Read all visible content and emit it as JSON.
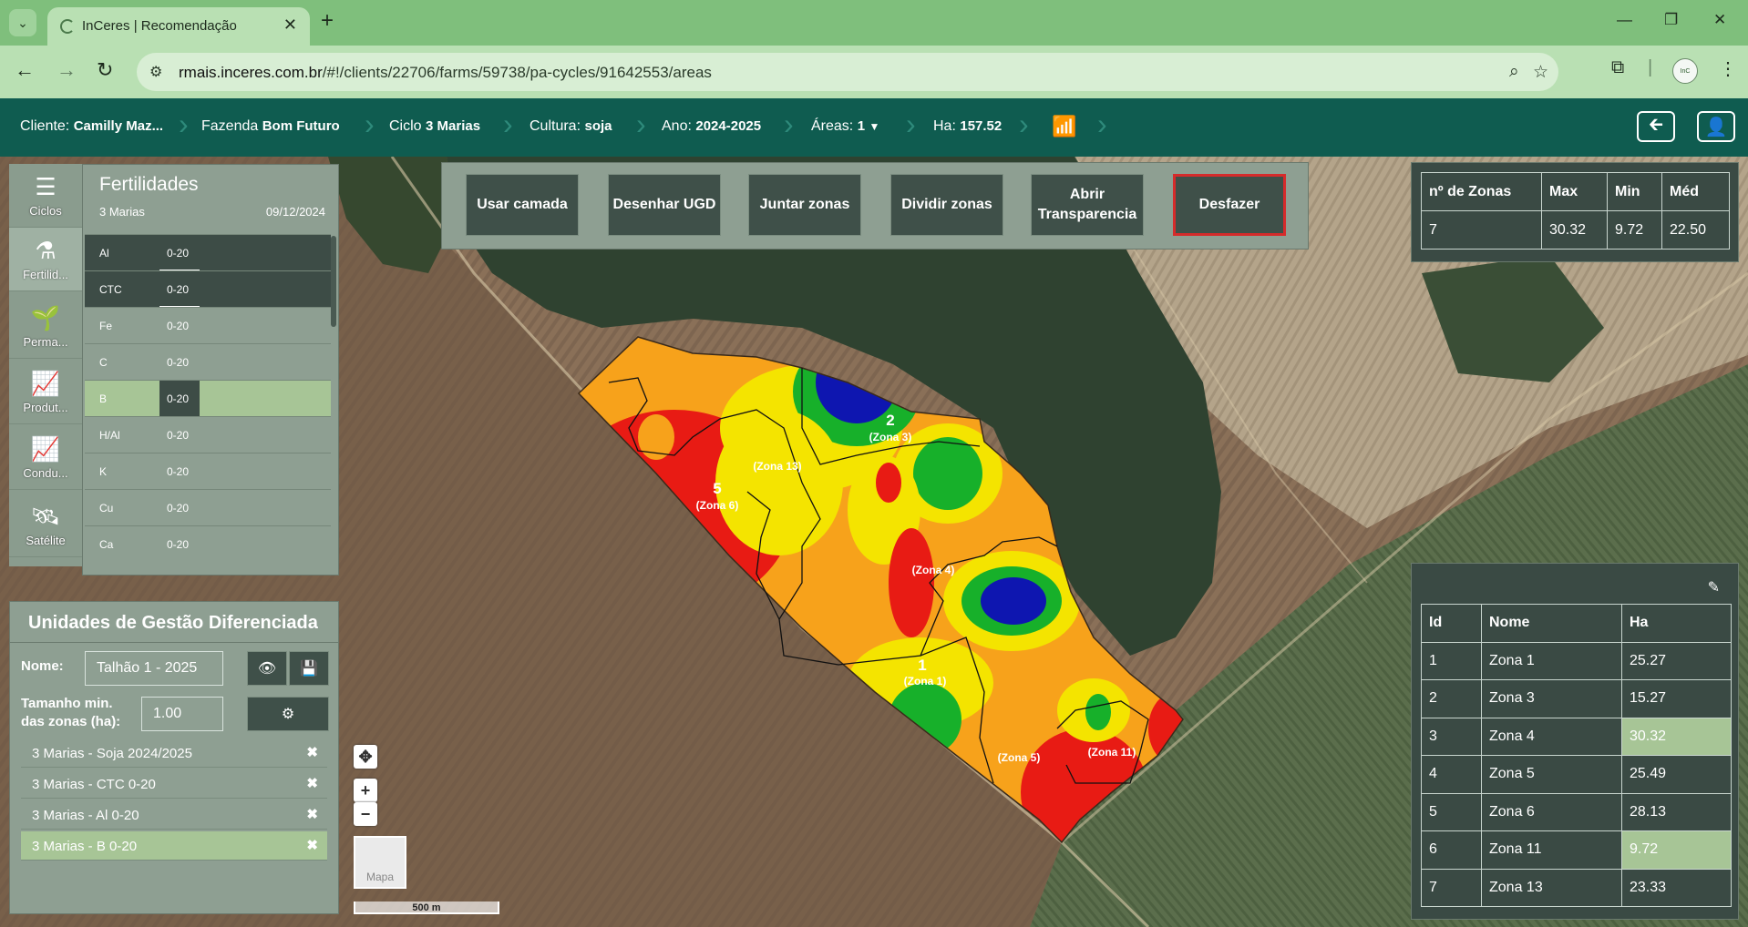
{
  "browser": {
    "tab_title": "InCeres | Recomendação",
    "url_host": "rmais.inceres.com.br",
    "url_path": "/#!/clients/22706/farms/59738/pa-cycles/91642553/areas"
  },
  "header": {
    "cliente_label": "Cliente:",
    "cliente_value": "Camilly Maz...",
    "fazenda_label": "Fazenda",
    "fazenda_value": "Bom Futuro",
    "ciclo_label": "Ciclo",
    "ciclo_value": "3 Marias",
    "cultura_label": "Cultura:",
    "cultura_value": "soja",
    "ano_label": "Ano:",
    "ano_value": "2024-2025",
    "areas_label": "Áreas:",
    "areas_value": "1",
    "ha_label": "Ha:",
    "ha_value": "157.52"
  },
  "rail": {
    "items": [
      {
        "label": "Ciclos"
      },
      {
        "label": "Fertilid..."
      },
      {
        "label": "Perma..."
      },
      {
        "label": "Produt..."
      },
      {
        "label": "Condu..."
      },
      {
        "label": "Satélite"
      }
    ]
  },
  "fertilidades": {
    "title": "Fertilidades",
    "subtitle": "3 Marias",
    "date": "09/12/2024",
    "rows": [
      {
        "name": "Al",
        "depth": "0-20"
      },
      {
        "name": "CTC",
        "depth": "0-20"
      },
      {
        "name": "Fe",
        "depth": "0-20"
      },
      {
        "name": "C",
        "depth": "0-20"
      },
      {
        "name": "B",
        "depth": "0-20"
      },
      {
        "name": "H/Al",
        "depth": "0-20"
      },
      {
        "name": "K",
        "depth": "0-20"
      },
      {
        "name": "Cu",
        "depth": "0-20"
      },
      {
        "name": "Ca",
        "depth": "0-20"
      }
    ]
  },
  "toolbar": {
    "buttons": [
      {
        "label": "Usar camada"
      },
      {
        "label": "Desenhar UGD"
      },
      {
        "label": "Juntar zonas"
      },
      {
        "label": "Dividir zonas"
      },
      {
        "label": "Abrir Transparencia"
      },
      {
        "label": "Desfazer"
      }
    ]
  },
  "stats": {
    "headers": [
      "nº de Zonas",
      "Max",
      "Min",
      "Méd"
    ],
    "values": [
      "7",
      "30.32",
      "9.72",
      "22.50"
    ]
  },
  "zones": {
    "headers": [
      "Id",
      "Nome",
      "Ha"
    ],
    "rows": [
      [
        "1",
        "Zona 1",
        "25.27"
      ],
      [
        "2",
        "Zona 3",
        "15.27"
      ],
      [
        "3",
        "Zona 4",
        "30.32"
      ],
      [
        "4",
        "Zona 5",
        "25.49"
      ],
      [
        "5",
        "Zona 6",
        "28.13"
      ],
      [
        "6",
        "Zona 11",
        "9.72"
      ],
      [
        "7",
        "Zona 13",
        "23.33"
      ]
    ]
  },
  "ugd": {
    "title": "Unidades de Gestão Diferenciada",
    "name_label": "Nome:",
    "name_value": "Talhão 1 - 2025",
    "size_label_1": "Tamanho min.",
    "size_label_2": "das zonas (ha):",
    "size_value": "1.00",
    "layers": [
      {
        "label": "3 Marias - Soja 2024/2025"
      },
      {
        "label": "3 Marias - CTC 0-20"
      },
      {
        "label": "3 Marias - Al 0-20"
      },
      {
        "label": "3 Marias - B 0-20"
      }
    ]
  },
  "map": {
    "zone_labels": [
      {
        "num": "2",
        "name": "(Zona 3)"
      },
      {
        "num": "",
        "name": "(Zona 13)"
      },
      {
        "num": "5",
        "name": "(Zona 6)"
      },
      {
        "num": "",
        "name": "(Zona 4)"
      },
      {
        "num": "1",
        "name": "(Zona 1)"
      },
      {
        "num": "",
        "name": "(Zona 5)"
      },
      {
        "num": "",
        "name": "(Zona 11)"
      }
    ],
    "layer_toggle": "Mapa",
    "scale": "500 m"
  }
}
